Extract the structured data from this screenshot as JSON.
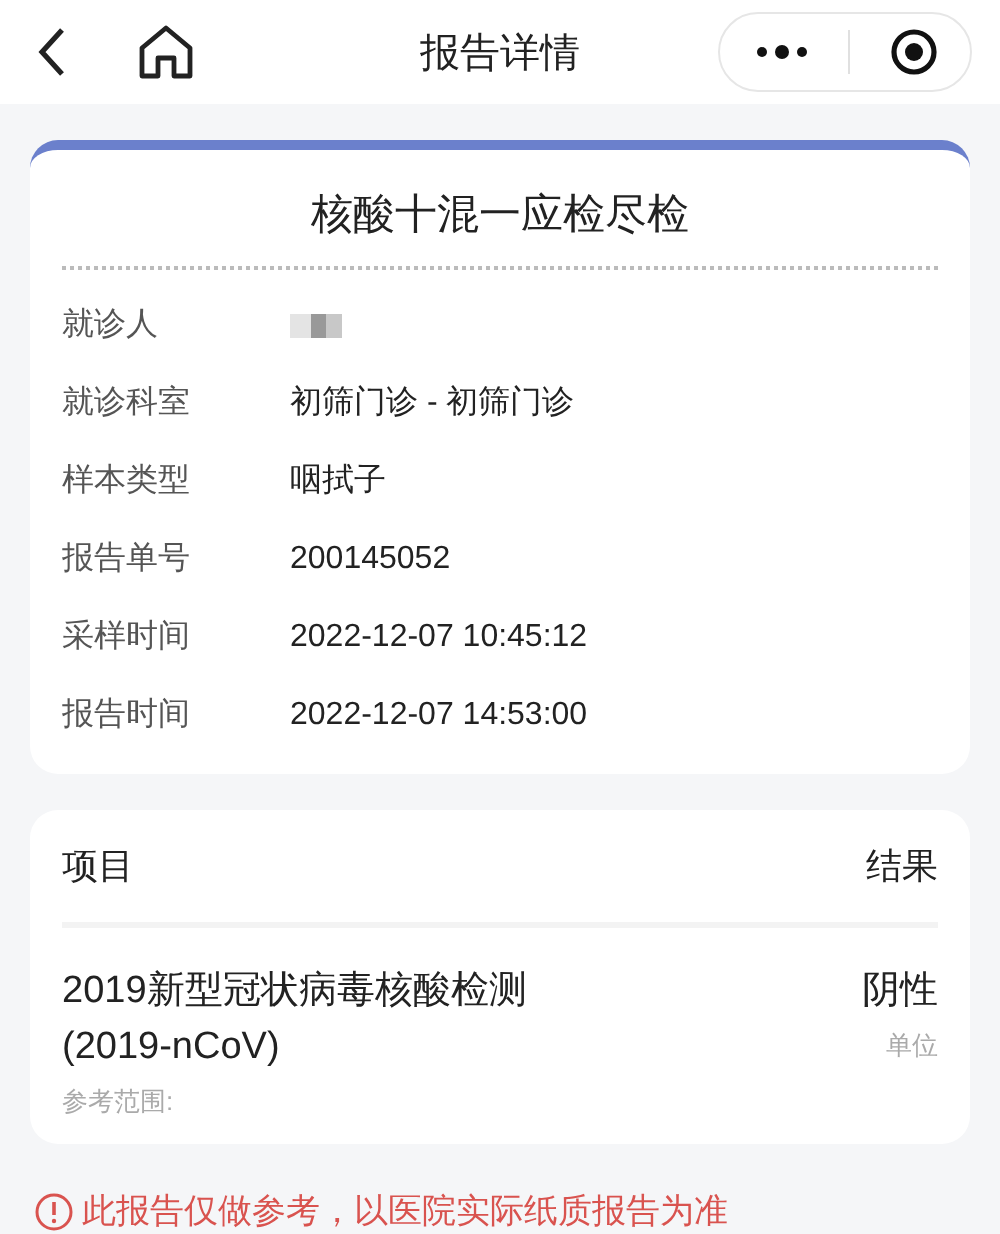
{
  "nav": {
    "title": "报告详情"
  },
  "report": {
    "title": "核酸十混一应检尽检",
    "fields": [
      {
        "label": "就诊人",
        "kind": "redacted"
      },
      {
        "label": "就诊科室",
        "value": "初筛门诊 - 初筛门诊",
        "kind": "text"
      },
      {
        "label": "样本类型",
        "value": "咽拭子",
        "kind": "text"
      },
      {
        "label": "报告单号",
        "value": "200145052",
        "kind": "text"
      },
      {
        "label": "采样时间",
        "value": "2022-12-07 10:45:12",
        "kind": "text"
      },
      {
        "label": "报告时间",
        "value": "2022-12-07 14:53:00",
        "kind": "text"
      }
    ]
  },
  "results": {
    "columns": [
      "项目",
      "结果"
    ],
    "rows": [
      {
        "item": "2019新型冠状病毒核酸检测(2019-nCoV)",
        "result": "阴性",
        "unit": "单位",
        "reference": "参考范围:"
      }
    ]
  },
  "notice": "此报告仅做参考，以医院实际纸质报告为准"
}
